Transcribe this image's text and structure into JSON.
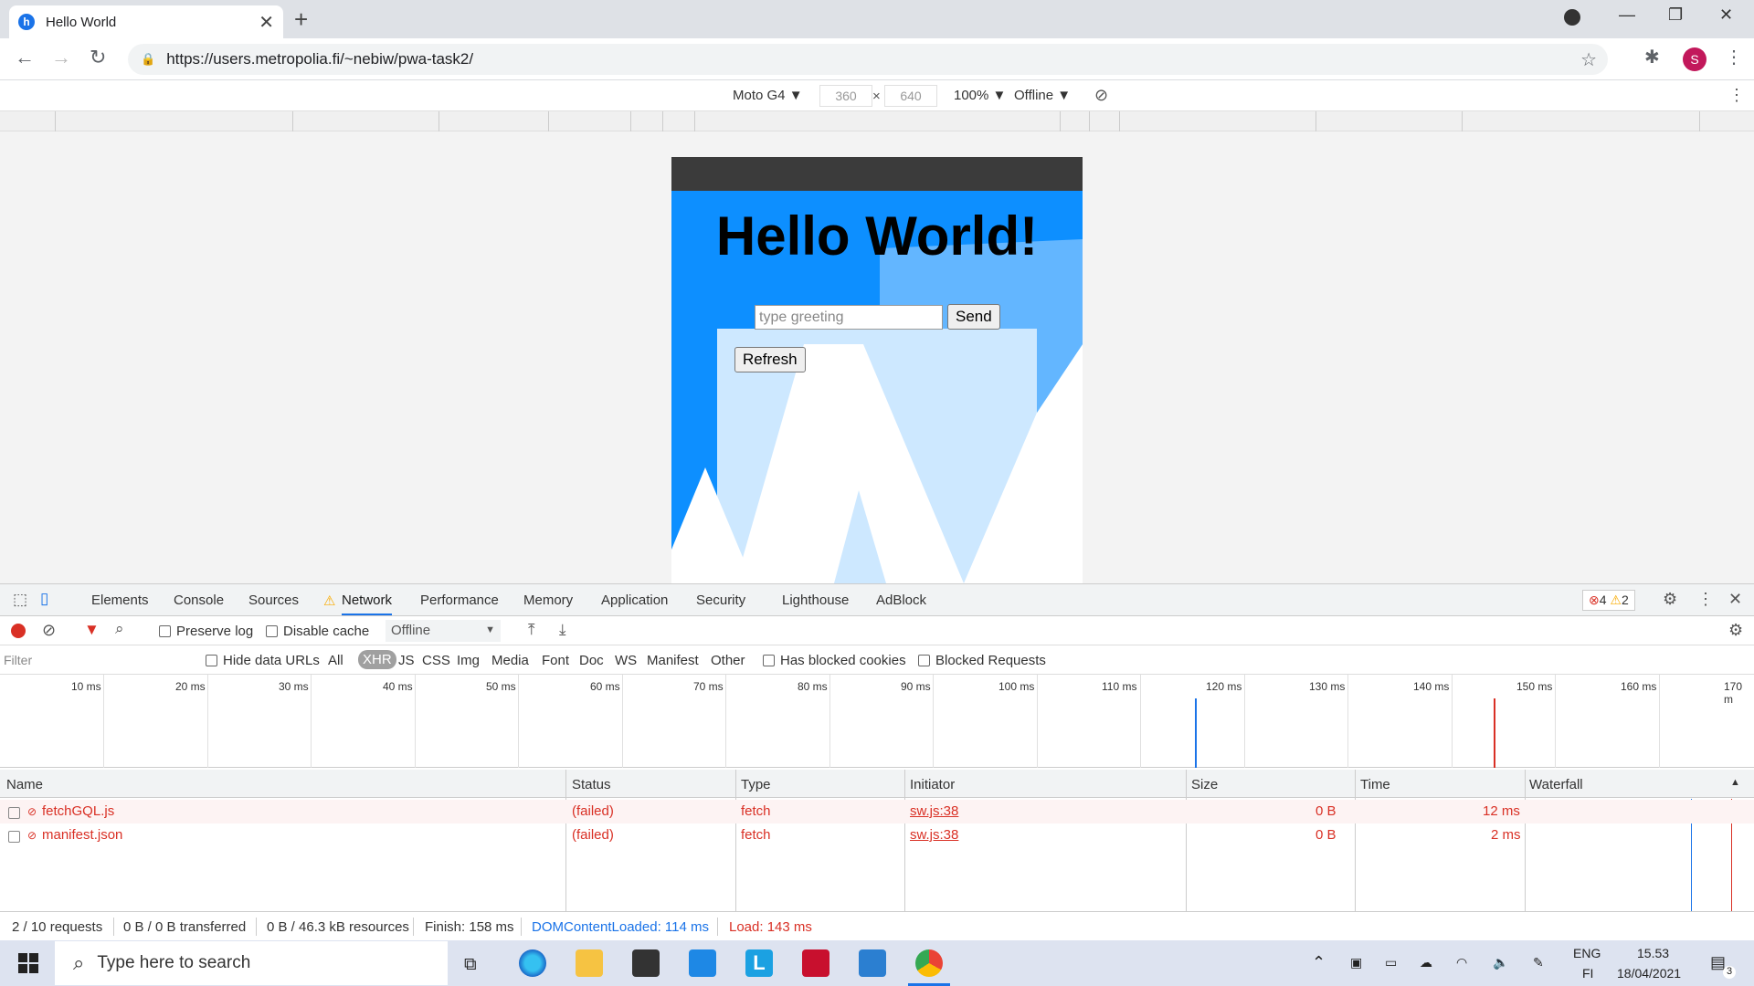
{
  "browser": {
    "tab_title": "Hello World",
    "tab_favicon_letter": "h",
    "url": "https://users.metropolia.fi/~nebiw/pwa-task2/",
    "profile_initial": "S"
  },
  "device_toolbar": {
    "device": "Moto G4 ▼",
    "width": "360",
    "height": "640",
    "x": "×",
    "zoom": "100% ▼",
    "throttle": "Offline ▼"
  },
  "page": {
    "heading": "Hello World!",
    "greeting_placeholder": "type greeting",
    "send_label": "Send",
    "refresh_label": "Refresh"
  },
  "devtools": {
    "tabs": [
      "Elements",
      "Console",
      "Sources",
      "Network",
      "Performance",
      "Memory",
      "Application",
      "Security",
      "Lighthouse",
      "AdBlock"
    ],
    "error_count": "4",
    "warning_count": "2",
    "preserve_log": "Preserve log",
    "disable_cache": "Disable cache",
    "throttle_select": "Offline",
    "filter_placeholder": "Filter",
    "hide_data_urls": "Hide data URLs",
    "filter_types": [
      "All",
      "XHR",
      "JS",
      "CSS",
      "Img",
      "Media",
      "Font",
      "Doc",
      "WS",
      "Manifest",
      "Other"
    ],
    "has_blocked_cookies": "Has blocked cookies",
    "blocked_requests": "Blocked Requests",
    "timeline_ticks": [
      "10 ms",
      "20 ms",
      "30 ms",
      "40 ms",
      "50 ms",
      "60 ms",
      "70 ms",
      "80 ms",
      "90 ms",
      "100 ms",
      "110 ms",
      "120 ms",
      "130 ms",
      "140 ms",
      "150 ms",
      "160 ms",
      "170 m"
    ],
    "columns": [
      "Name",
      "Status",
      "Type",
      "Initiator",
      "Size",
      "Time",
      "Waterfall"
    ],
    "rows": [
      {
        "name": "fetchGQL.js",
        "status": "(failed)",
        "type": "fetch",
        "initiator": "sw.js:38",
        "size": "0 B",
        "time": "12 ms"
      },
      {
        "name": "manifest.json",
        "status": "(failed)",
        "type": "fetch",
        "initiator": "sw.js:38",
        "size": "0 B",
        "time": "2 ms"
      }
    ],
    "status": {
      "requests": "2 / 10 requests",
      "transferred": "0 B / 0 B transferred",
      "resources": "0 B / 46.3 kB resources",
      "finish": "Finish: 158 ms",
      "dcl": "DOMContentLoaded: 114 ms",
      "load": "Load: 143 ms"
    }
  },
  "taskbar": {
    "search_placeholder": "Type here to search",
    "lang1": "ENG",
    "lang2": "FI",
    "time": "15.53",
    "date": "18/04/2021",
    "notif_count": "3"
  },
  "colors": {
    "accent": "#1a73e8",
    "error": "#d93025",
    "page_blue": "#0d8fff"
  }
}
